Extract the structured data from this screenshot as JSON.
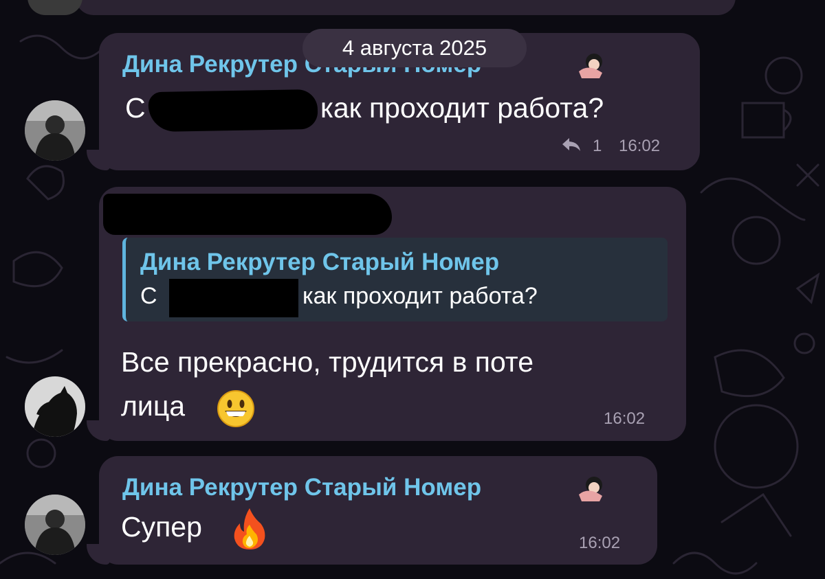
{
  "date_separator": "4 августа 2025",
  "messages": [
    {
      "sender": "Дина Рекрутер Старый Номер",
      "text_prefix": "С",
      "text_suffix": "как проходит работа?",
      "replies_count": "1",
      "time": "16:02"
    },
    {
      "reply_quote": {
        "sender": "Дина Рекрутер Старый Номер",
        "text_prefix": "С",
        "text_suffix": "как проходит работа?"
      },
      "text_line1": "Все прекрасно, трудится в поте",
      "text_line2": "лица",
      "emoji": "grinning-face",
      "time": "16:02"
    },
    {
      "sender": "Дина Рекрутер Старый Номер",
      "text": "Супер",
      "emoji": "fire",
      "time": "16:02"
    }
  ],
  "colors": {
    "background": "#0c0b12",
    "bubble": "#2e2536",
    "sender_name": "#6fc5ea",
    "quote_bar": "#5fb4de",
    "time": "#a9a1b3"
  }
}
